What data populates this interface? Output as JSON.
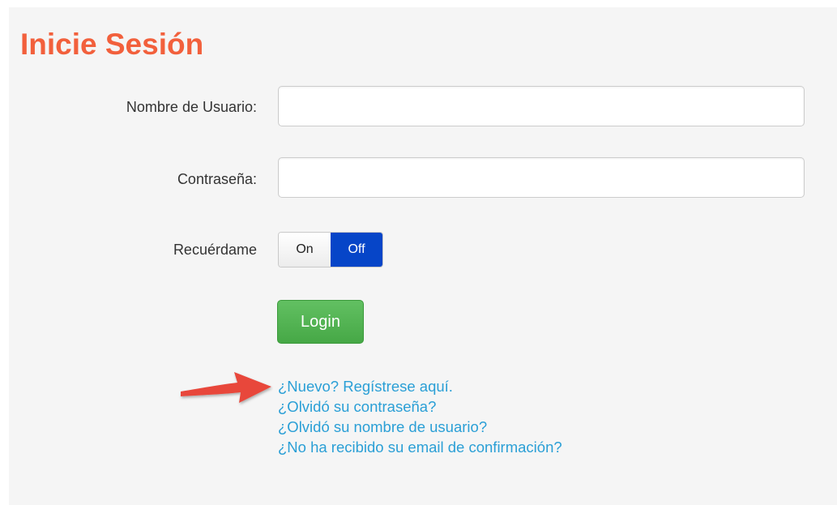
{
  "login_form": {
    "title": "Inicie Sesión",
    "username": {
      "label": "Nombre de Usuario:",
      "value": "",
      "placeholder": ""
    },
    "password": {
      "label": "Contraseña:",
      "value": "",
      "placeholder": ""
    },
    "remember_me": {
      "label": "Recuérdame",
      "on_label": "On",
      "off_label": "Off",
      "selected": "Off"
    },
    "login_button": "Login",
    "links": [
      "¿Nuevo? Regístrese aquí.",
      "¿Olvidó su contraseña?",
      "¿Olvidó su nombre de usuario?",
      "¿No ha recibido su email de confirmación?"
    ]
  },
  "colors": {
    "title": "#f2603c",
    "panel_background": "#f5f5f5",
    "toggle_active": "#0645c8",
    "login_button": "#4cae4c",
    "link": "#2a9fd6",
    "annotation_arrow": "#e8473a"
  },
  "icons": {
    "annotation": "red-arrow-icon"
  }
}
